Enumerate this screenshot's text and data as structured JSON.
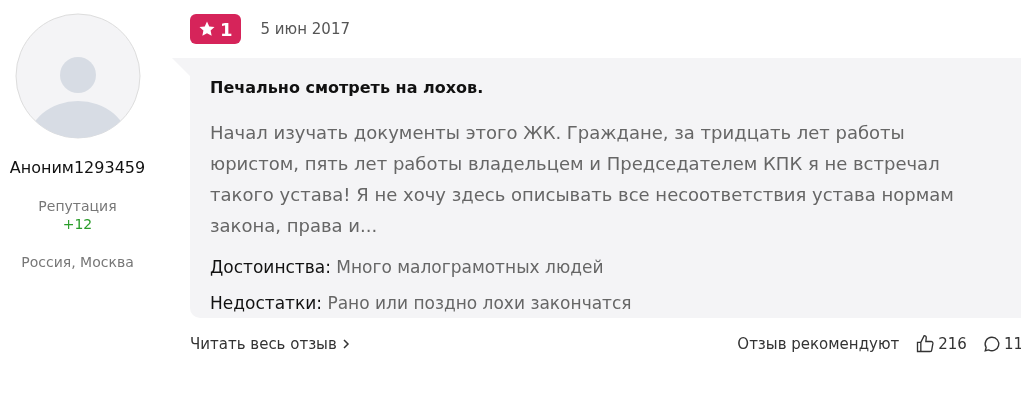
{
  "author": {
    "name": "Аноним1293459",
    "reputation_label": "Репутация",
    "reputation": "+12",
    "location": "Россия, Москва"
  },
  "review": {
    "rating": "1",
    "date": "5 июн 2017",
    "title": "Печально смотреть на лохов.",
    "text": "Начал изучать документы этого ЖК. Граждане, за тридцать лет работы юристом, пять лет работы владельцем и Председателем КПК я не встречал такого устава! Я не хочу здесь описывать все несоответствия устава нормам закона, права и...",
    "pros_label": "Достоинства:",
    "pros": "Много малограмотных людей",
    "cons_label": "Недостатки:",
    "cons": "Рано или поздно лохи закончатся"
  },
  "footer": {
    "read_more": "Читать весь отзыв",
    "recommend_label": "Отзыв рекомендуют",
    "likes": "216",
    "comments": "11"
  }
}
